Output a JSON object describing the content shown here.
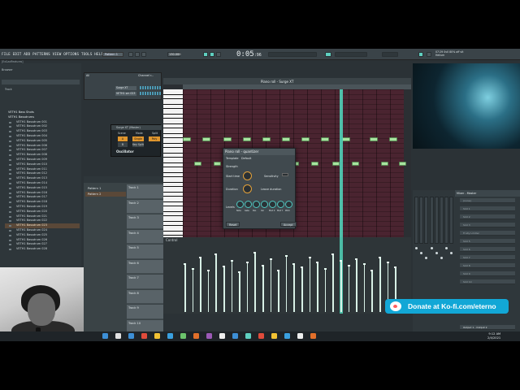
{
  "menu": {
    "items": "FILE  EDIT  ADD  PATTERNS  VIEW  OPTIONS  TOOLS  HELP",
    "hint_line1": "[Ex&adFeatures]",
    "hint_line2": "Mode starting bass strength"
  },
  "toolbar": {
    "pattern": "Pattern 1",
    "tempo": "130.000",
    "time_main": "0:05",
    "time_sub": ":96"
  },
  "status": {
    "line1": "07:29  0v0 80% off vlt",
    "line2": "Helium"
  },
  "browser": {
    "title": "Browser",
    "search": "Track",
    "items": [
      {
        "label": "VETH1 Bass Shots",
        "type": "folder"
      },
      {
        "label": "VETH1 Bassdrums",
        "type": "folder"
      },
      {
        "label": "VETH1 Bassdrum 001"
      },
      {
        "label": "VETH1 Bassdrum 002"
      },
      {
        "label": "VETH1 Bassdrum 003"
      },
      {
        "label": "VETH1 Bassdrum 004"
      },
      {
        "label": "VETH1 Bassdrum 005"
      },
      {
        "label": "VETH1 Bassdrum 006"
      },
      {
        "label": "VETH1 Bassdrum 007"
      },
      {
        "label": "VETH1 Bassdrum 008"
      },
      {
        "label": "VETH1 Bassdrum 009"
      },
      {
        "label": "VETH1 Bassdrum 010"
      },
      {
        "label": "VETH1 Bassdrum 011"
      },
      {
        "label": "VETH1 Bassdrum 012"
      },
      {
        "label": "VETH1 Bassdrum 013"
      },
      {
        "label": "VETH1 Bassdrum 014"
      },
      {
        "label": "VETH1 Bassdrum 015"
      },
      {
        "label": "VETH1 Bassdrum 016"
      },
      {
        "label": "VETH1 Bassdrum 017"
      },
      {
        "label": "VETH1 Bassdrum 018"
      },
      {
        "label": "VETH1 Bassdrum 019"
      },
      {
        "label": "VETH1 Bassdrum 020"
      },
      {
        "label": "VETH1 Bassdrum 021"
      },
      {
        "label": "VETH1 Bassdrum 022"
      },
      {
        "label": "VETH1 Bassdrum 023",
        "selected": true
      },
      {
        "label": "VETH1 Bassdrum 024"
      },
      {
        "label": "VETH1 Bassdrum 025"
      },
      {
        "label": "VETH1 Bassdrum 026"
      },
      {
        "label": "VETH1 Bassdrum 027"
      },
      {
        "label": "VETH1 Bassdrum 028"
      }
    ]
  },
  "channel_rack": {
    "title": "Channel r...",
    "filter": "All",
    "channels": [
      "Surge XT",
      "VETH1 sm 023"
    ]
  },
  "synth": {
    "title": "Surge XT (Master)",
    "scene": "Scene",
    "mode": "Mode",
    "split": "Split",
    "a": "A",
    "b": "B",
    "single": "Single",
    "keysplit": "Key Split",
    "poly": "Poly",
    "osc": "Oscillator"
  },
  "playlist": {
    "patterns": [
      "Pattern 1",
      "Pattern 2"
    ],
    "tracks": [
      "Track 1",
      "Track 2",
      "Track 3",
      "Track 4",
      "Track 5",
      "Track 6",
      "Track 7",
      "Track 8",
      "Track 9",
      "Track 10"
    ]
  },
  "piano_roll": {
    "title": "Piano roll - Surge XT",
    "control": "Control"
  },
  "quantizer": {
    "title": "Piano roll - quantizer",
    "template_label": "Template",
    "template_value": "Default",
    "strength": "Strength",
    "start_time": "Start time",
    "sensitivity": "Sensitivity",
    "duration": "Duration",
    "leave_duration": "Leave duration",
    "levels": "Levels",
    "level_names": [
      "Note",
      "Gate",
      "Pan",
      "Vel",
      "Mod X",
      "Mod Y",
      "Pitch"
    ],
    "reset": "Reset",
    "accept": "Accept"
  },
  "mixer": {
    "title": "Mixer - Master",
    "slot_top": "(none)",
    "slots": [
      "Slot 1",
      "Slot 2",
      "Slot 3",
      "Fruity Limiter",
      "Slot 5",
      "Slot 6",
      "Slot 7",
      "Slot 8",
      "Slot 9",
      "Slot 10"
    ],
    "output": "Output 1 - Output 2"
  },
  "donate": {
    "text": "Donate at Ko-fi.com/eterno"
  },
  "clock": {
    "time": "9:12 AM",
    "date": "2/4/2021"
  },
  "colors": {
    "accent": "#50d2b8",
    "note": "#a8e4a0",
    "grid": "#4a2430",
    "kofi": "#12a7d6"
  }
}
